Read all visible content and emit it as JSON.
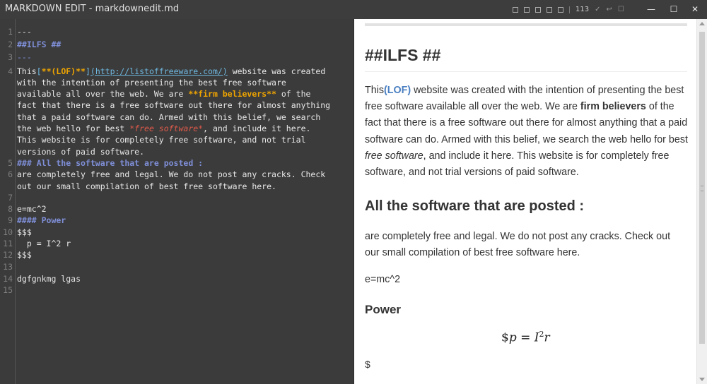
{
  "window": {
    "title": "MARKDOWN EDIT - markdownedit.md",
    "minimize": "—",
    "maximize": "☐",
    "close": "✕"
  },
  "toolbar": {
    "word_count": "113",
    "check_glyph": "✓",
    "wrap_glyph": "↩",
    "box_glyph": "☐"
  },
  "editor": {
    "line_numbers": [
      "1",
      "2",
      "3",
      "4",
      "",
      "",
      "",
      "",
      "",
      "",
      "",
      "5",
      "6",
      "",
      "7",
      "8",
      "9",
      "10",
      "11",
      "12",
      "13",
      "14",
      "15"
    ],
    "l1": "---",
    "l2": "##ILFS ##",
    "l3": "---",
    "l4_this": "This",
    "l4_lb": "[",
    "l4_bold": "**(LOF)**",
    "l4_rb": "]",
    "l4_url": "(http://listoffreeware.com/)",
    "l4_rest": " website was created",
    "l4b": "with the intention of presenting the best free software",
    "l4c_pre": "available all over the web. We are ",
    "l4c_bold": "**firm believers**",
    "l4c_post": " of the",
    "l4d": "fact that there is a free software out there for almost anything",
    "l4e": "that a paid software can do. Armed with this belief, we search",
    "l4f_pre": "the web hello for best ",
    "l4f_ital": "*free software*",
    "l4f_post": ", and include it here.",
    "l4g": "This website is for completely free software, and not trial",
    "l4h": "versions of paid software.",
    "l5": "### All the software that are posted :",
    "l6a": "are completely free and legal. We do not post any cracks. Check",
    "l6b": "out our small compilation of best free software here.",
    "l7": "",
    "l8": "e=mc^2",
    "l9": "#### Power",
    "l10": "$$$",
    "l11": "  p = I^2 r",
    "l12": "$$$",
    "l13": "",
    "l14": "dgfgnkmg lgas",
    "l15": ""
  },
  "preview": {
    "heading": "##ILFS ##",
    "p1_this": "This",
    "p1_link": "(LOF)",
    "p1_a": " website was created with the intention of presenting the best free software available all over the web. We are ",
    "p1_bold": "firm believers",
    "p1_b": " of the fact that there is a free software out there for almost anything that a paid software can do. Armed with this belief, we search the web hello for best ",
    "p1_ital": "free software",
    "p1_c": ", and include it here. This website is for completely free software, and not trial versions of paid software.",
    "h3": "All the software that are posted :",
    "p2": "are completely free and legal. We do not post any cracks. Check out our small compilation of best free software here.",
    "p3": "e=mc^2",
    "h4": "Power",
    "math_dollar": "$",
    "math_p": "p",
    "math_eq": " = ",
    "math_I": "I",
    "math_sup": "2",
    "math_r": "r",
    "trail_dollar": "$"
  }
}
